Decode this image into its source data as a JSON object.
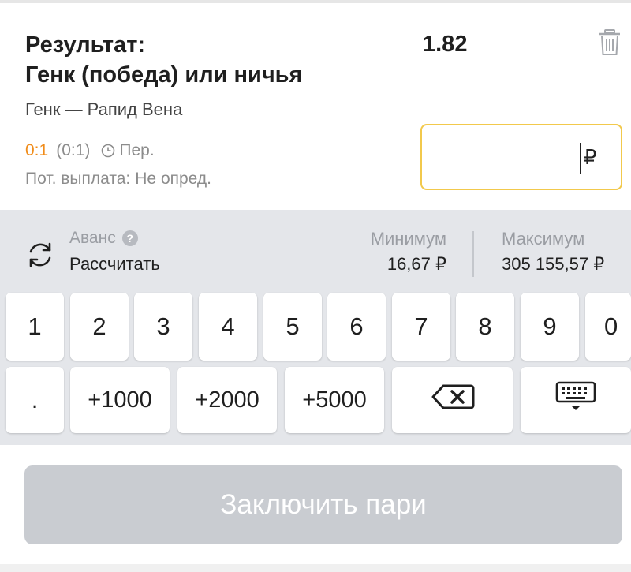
{
  "bet": {
    "title_line1": "Результат:",
    "title_line2": "Генк (победа) или ничья",
    "odds": "1.82",
    "match": "Генк — Рапид Вена",
    "score": "0:1",
    "score_half": "(0:1)",
    "period": "Пер.",
    "payout_label": "Пот. выплата:",
    "payout_value": "Не опред.",
    "amount_value": "",
    "currency": "₽",
    "icons": {
      "delete": "trash-icon",
      "clock": "clock-icon"
    },
    "colors": {
      "score": "#f08c1a",
      "input_border": "#f2c94c"
    }
  },
  "panel": {
    "avans_label": "Аванс",
    "help": "?",
    "calculate": "Рассчитать",
    "min_label": "Минимум",
    "min_value": "16,67 ₽",
    "max_label": "Максимум",
    "max_value": "305 155,57 ₽",
    "icons": {
      "refresh": "refresh-icon"
    }
  },
  "keypad": {
    "digits": [
      "1",
      "2",
      "3",
      "4",
      "5",
      "6",
      "7",
      "8",
      "9",
      "0"
    ],
    "dot": ".",
    "quick": [
      "+1000",
      "+2000",
      "+5000"
    ],
    "icons": {
      "backspace": "backspace-icon",
      "keyboard": "keyboard-icon"
    }
  },
  "confirm_button": "Заключить пари"
}
